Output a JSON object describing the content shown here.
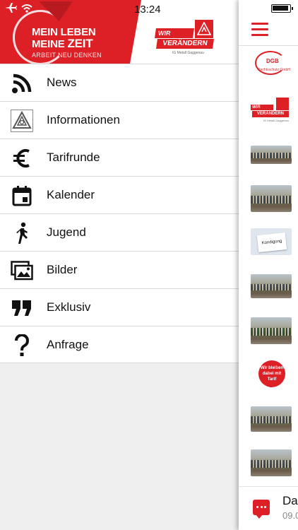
{
  "status_bar": {
    "time": "13:24"
  },
  "banner": {
    "slogan_line1": "MEIN LEBEN",
    "slogan_line2a": "MEINE",
    "slogan_line2b": "ZEIT",
    "slogan_line3": "ARBEIT NEU DENKEN",
    "logo_wir": "WIR",
    "logo_veraendern": "VERÄNDERN",
    "logo_sub": "IG Metall Gaggenau"
  },
  "menu": {
    "items": [
      {
        "label": "News",
        "icon": "rss-icon"
      },
      {
        "label": "Informationen",
        "icon": "igm-logo-icon"
      },
      {
        "label": "Tarifrunde",
        "icon": "euro-icon"
      },
      {
        "label": "Kalender",
        "icon": "calendar-icon"
      },
      {
        "label": "Jugend",
        "icon": "walking-person-icon"
      },
      {
        "label": "Bilder",
        "icon": "images-icon"
      },
      {
        "label": "Exklusiv",
        "icon": "quote-icon"
      },
      {
        "label": "Anfrage",
        "icon": "question-icon"
      }
    ]
  },
  "right_panel": {
    "thumb_dgb_text": "DGB",
    "thumb_dgb_sub": "Rechtsschutz GmbH",
    "thumb_logo_wir": "WIR",
    "thumb_logo_veraendern": "VERÄNDERN",
    "thumb_logo_sub": "IG Metall Gaggenau",
    "thumb_doc_text": "Kündigung",
    "badge_text": "Wir bleiben dabei mit Tarif",
    "last_item_title": "Da",
    "last_item_date": "09.0"
  },
  "colors": {
    "brand_red": "#dd1f26"
  }
}
